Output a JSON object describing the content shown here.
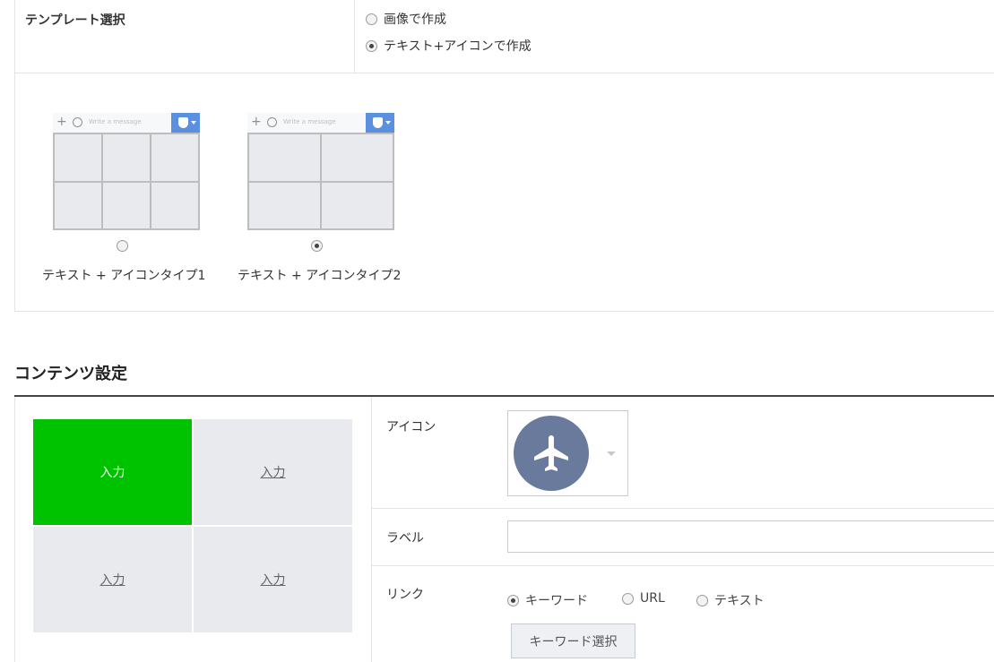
{
  "template": {
    "label": "テンプレート選択",
    "options": [
      {
        "label": "画像で作成",
        "checked": false
      },
      {
        "label": "テキスト+アイコンで作成",
        "checked": true
      }
    ],
    "thumbnails": [
      {
        "label": "テキスト + アイコンタイプ1",
        "placeholder": "Write a message",
        "checked": false
      },
      {
        "label": "テキスト + アイコンタイプ2",
        "placeholder": "Write a message",
        "checked": true
      }
    ]
  },
  "content": {
    "title": "コンテンツ設定",
    "cells": [
      {
        "label": "入力",
        "active": true
      },
      {
        "label": "入力",
        "active": false
      },
      {
        "label": "入力",
        "active": false
      },
      {
        "label": "入力",
        "active": false
      }
    ],
    "icon_label": "アイコン",
    "icon": "airplane-icon",
    "label_label": "ラベル",
    "label_value": "",
    "link_label": "リンク",
    "link_options": [
      {
        "label": "キーワード",
        "checked": true
      },
      {
        "label": "URL",
        "checked": false
      },
      {
        "label": "テキスト",
        "checked": false
      }
    ],
    "keyword_button": "キーワード選択"
  },
  "colors": {
    "active_cell": "#00c300",
    "icon_bg": "#6a7a9d",
    "thumb_badge": "#5b8fe0"
  }
}
